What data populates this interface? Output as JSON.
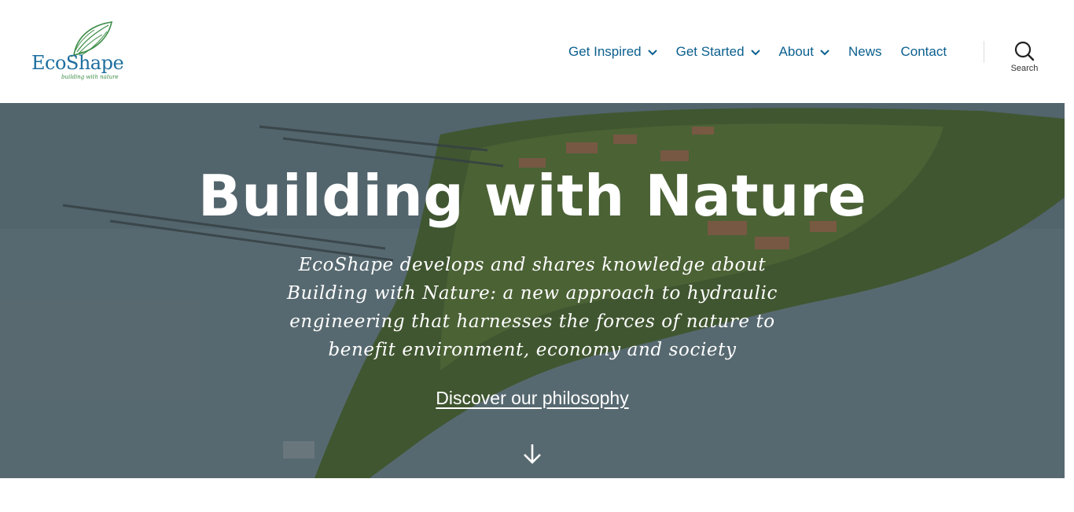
{
  "logo": {
    "name": "EcoShape",
    "tagline": "building with nature",
    "icon": "leaf-logo-icon"
  },
  "nav": {
    "items": [
      {
        "label": "Get Inspired",
        "has_dropdown": true
      },
      {
        "label": "Get Started",
        "has_dropdown": true
      },
      {
        "label": "About",
        "has_dropdown": true
      },
      {
        "label": "News",
        "has_dropdown": false
      },
      {
        "label": "Contact",
        "has_dropdown": false
      }
    ]
  },
  "search": {
    "label": "Search",
    "icon": "search-icon"
  },
  "hero": {
    "title": "Building with Nature",
    "text": "EcoShape develops and shares knowledge about Building with Nature: a new approach to hydraulic engineering that harnesses the forces of nature to benefit environment, economy and society",
    "link_label": "Discover our philosophy",
    "scroll_icon": "arrow-down-icon"
  },
  "colors": {
    "nav_text": "#0b5f8e",
    "logo_blue": "#1f6fa0",
    "logo_green": "#3b8c45",
    "hero_text": "#ffffff"
  }
}
